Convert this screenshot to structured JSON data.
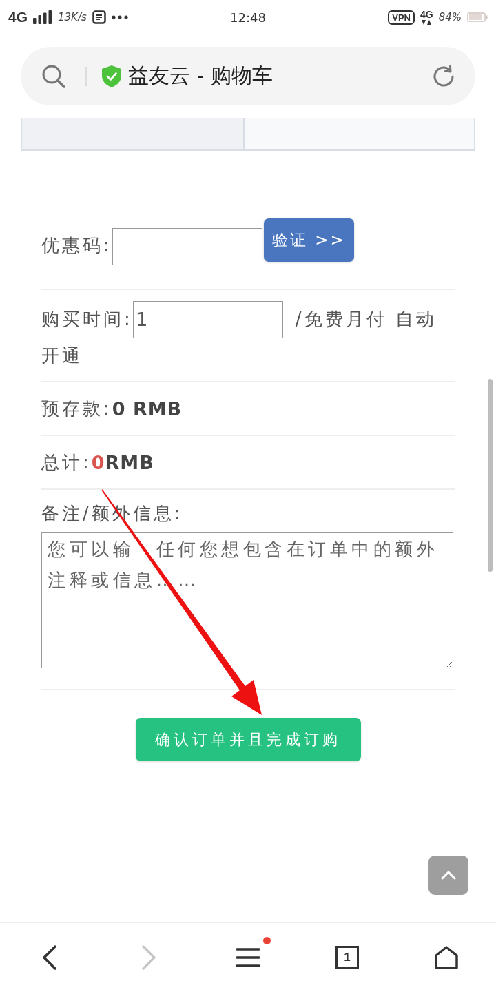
{
  "status_bar": {
    "network": "4G",
    "speed": "13K/s",
    "time": "12:48",
    "vpn": "VPN",
    "network_right": "4G",
    "battery": "84%"
  },
  "address_bar": {
    "secure": true,
    "title": "益友云 - 购物车"
  },
  "coupon": {
    "label": "优惠码:",
    "button": "验证 >>"
  },
  "purchase_time": {
    "label": "购买时间:",
    "value": "1",
    "note_lines": [
      "/免费月付 自动",
      "开通"
    ]
  },
  "deposit": {
    "label": "预存款:",
    "value": "0 RMB"
  },
  "total": {
    "label": "总计:",
    "amount": "0",
    "unit": "RMB"
  },
  "notes": {
    "label": "备注/额外信息:",
    "placeholder": "您可以输　任何您想包含在订单中的额外注释或信息……"
  },
  "submit_button": "确认订单并且完成订购",
  "nav": [
    {
      "kind": "back",
      "disabled": false
    },
    {
      "kind": "forward",
      "disabled": true
    },
    {
      "kind": "menu",
      "disabled": false,
      "notification": true
    },
    {
      "kind": "tabs",
      "disabled": false,
      "label": "1"
    },
    {
      "kind": "home",
      "disabled": false
    }
  ]
}
